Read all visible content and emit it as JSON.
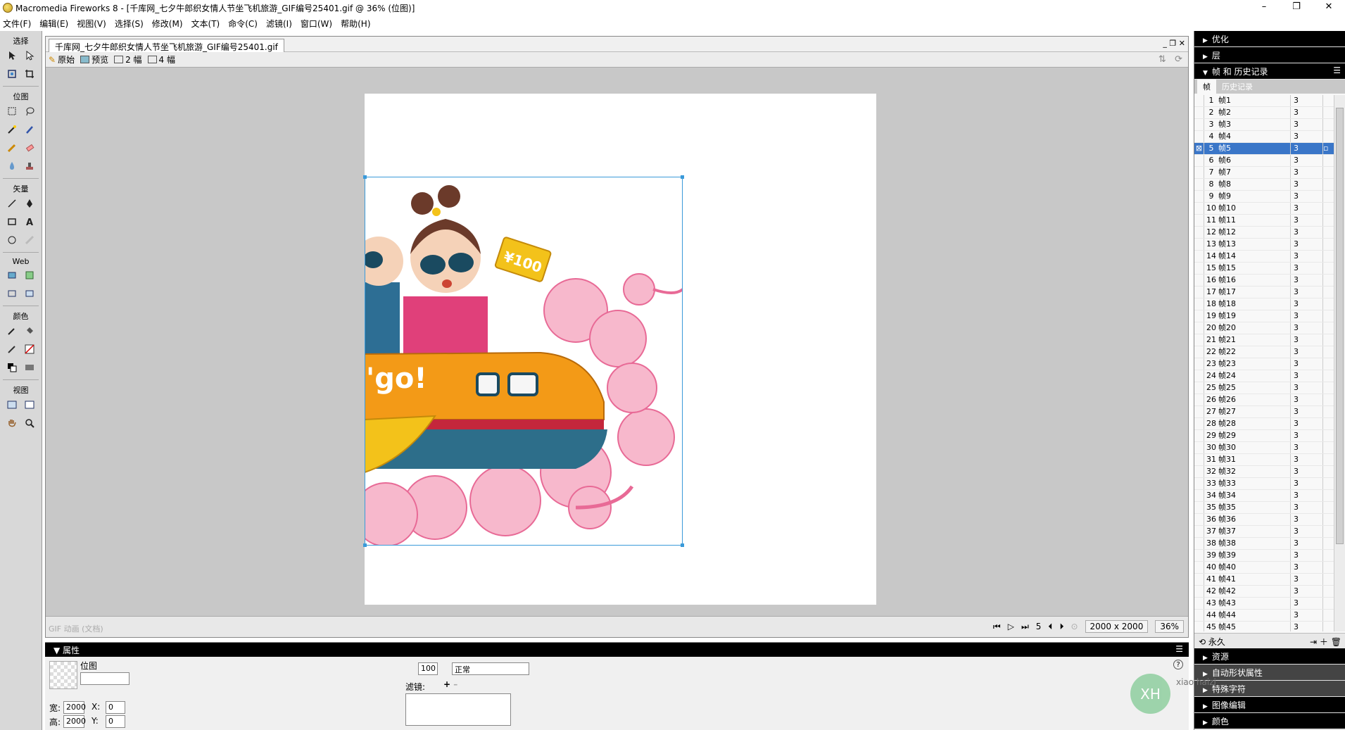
{
  "app": {
    "title": "Macromedia Fireworks 8 - [千库网_七夕牛郎织女情人节坐飞机旅游_GIF编号25401.gif @  36% (位图)]",
    "win_min": "–",
    "win_max": "❐",
    "win_close": "✕"
  },
  "menu": [
    "文件(F)",
    "编辑(E)",
    "视图(V)",
    "选择(S)",
    "修改(M)",
    "文本(T)",
    "命令(C)",
    "滤镜(I)",
    "窗口(W)",
    "帮助(H)"
  ],
  "toolbox": {
    "sections": {
      "select": "选择",
      "bitmap": "位图",
      "vector": "矢量",
      "web": "Web",
      "colors": "颜色",
      "view": "视图"
    }
  },
  "document": {
    "tab_label": "千库网_七夕牛郎织女情人节坐飞机旅游_GIF编号25401.gif",
    "winctl": "_ ❐ ✕",
    "views": {
      "original": "原始",
      "preview": "预览",
      "two_up": "2 幅",
      "four_up": "4 幅"
    },
    "status_left": "GIF 动画 (文档)",
    "current_frame": "5",
    "doc_size": "2000 x 2000",
    "zoom": "36%"
  },
  "illustration": {
    "ticket_text": "¥100",
    "train_text": "'go!"
  },
  "properties": {
    "header": "属性",
    "object_type": "位图",
    "object_name": "",
    "width_label": "宽:",
    "width": "2000",
    "height_label": "高:",
    "height": "2000",
    "x_label": "X:",
    "x": "0",
    "y_label": "Y:",
    "y": "0",
    "opacity": "100",
    "blend_mode": "正常",
    "filters_label": "滤镜:",
    "help": "?"
  },
  "panels": {
    "optimize": "优化",
    "layers": "层",
    "frames_history": "帧 和 历史记录",
    "tab_frames": "帧",
    "tab_history": "历史记录",
    "loop_label": "永久",
    "assets": "资源",
    "autoshape_props": "自动形状属性",
    "special_chars": "特殊字符",
    "image_edit": "图像编辑",
    "colors": "颜色"
  },
  "frames": [
    {
      "num": "1",
      "name": "帧1",
      "delay": "3"
    },
    {
      "num": "2",
      "name": "帧2",
      "delay": "3"
    },
    {
      "num": "3",
      "name": "帧3",
      "delay": "3"
    },
    {
      "num": "4",
      "name": "帧4",
      "delay": "3"
    },
    {
      "num": "5",
      "name": "帧5",
      "delay": "3"
    },
    {
      "num": "6",
      "name": "帧6",
      "delay": "3"
    },
    {
      "num": "7",
      "name": "帧7",
      "delay": "3"
    },
    {
      "num": "8",
      "name": "帧8",
      "delay": "3"
    },
    {
      "num": "9",
      "name": "帧9",
      "delay": "3"
    },
    {
      "num": "10",
      "name": "帧10",
      "delay": "3"
    },
    {
      "num": "11",
      "name": "帧11",
      "delay": "3"
    },
    {
      "num": "12",
      "name": "帧12",
      "delay": "3"
    },
    {
      "num": "13",
      "name": "帧13",
      "delay": "3"
    },
    {
      "num": "14",
      "name": "帧14",
      "delay": "3"
    },
    {
      "num": "15",
      "name": "帧15",
      "delay": "3"
    },
    {
      "num": "16",
      "name": "帧16",
      "delay": "3"
    },
    {
      "num": "17",
      "name": "帧17",
      "delay": "3"
    },
    {
      "num": "18",
      "name": "帧18",
      "delay": "3"
    },
    {
      "num": "19",
      "name": "帧19",
      "delay": "3"
    },
    {
      "num": "20",
      "name": "帧20",
      "delay": "3"
    },
    {
      "num": "21",
      "name": "帧21",
      "delay": "3"
    },
    {
      "num": "22",
      "name": "帧22",
      "delay": "3"
    },
    {
      "num": "23",
      "name": "帧23",
      "delay": "3"
    },
    {
      "num": "24",
      "name": "帧24",
      "delay": "3"
    },
    {
      "num": "25",
      "name": "帧25",
      "delay": "3"
    },
    {
      "num": "26",
      "name": "帧26",
      "delay": "3"
    },
    {
      "num": "27",
      "name": "帧27",
      "delay": "3"
    },
    {
      "num": "28",
      "name": "帧28",
      "delay": "3"
    },
    {
      "num": "29",
      "name": "帧29",
      "delay": "3"
    },
    {
      "num": "30",
      "name": "帧30",
      "delay": "3"
    },
    {
      "num": "31",
      "name": "帧31",
      "delay": "3"
    },
    {
      "num": "32",
      "name": "帧32",
      "delay": "3"
    },
    {
      "num": "33",
      "name": "帧33",
      "delay": "3"
    },
    {
      "num": "34",
      "name": "帧34",
      "delay": "3"
    },
    {
      "num": "35",
      "name": "帧35",
      "delay": "3"
    },
    {
      "num": "36",
      "name": "帧36",
      "delay": "3"
    },
    {
      "num": "37",
      "name": "帧37",
      "delay": "3"
    },
    {
      "num": "38",
      "name": "帧38",
      "delay": "3"
    },
    {
      "num": "39",
      "name": "帧39",
      "delay": "3"
    },
    {
      "num": "40",
      "name": "帧40",
      "delay": "3"
    },
    {
      "num": "41",
      "name": "帧41",
      "delay": "3"
    },
    {
      "num": "42",
      "name": "帧42",
      "delay": "3"
    },
    {
      "num": "43",
      "name": "帧43",
      "delay": "3"
    },
    {
      "num": "44",
      "name": "帧44",
      "delay": "3"
    },
    {
      "num": "45",
      "name": "帧45",
      "delay": "3"
    }
  ],
  "selected_frame_index": 4,
  "watermark": {
    "badge": "XH",
    "text": "xiao haizi"
  },
  "colors": {
    "selection": "#3a9ad9",
    "selected_row": "#3a76c8",
    "panel_header": "#000000"
  }
}
